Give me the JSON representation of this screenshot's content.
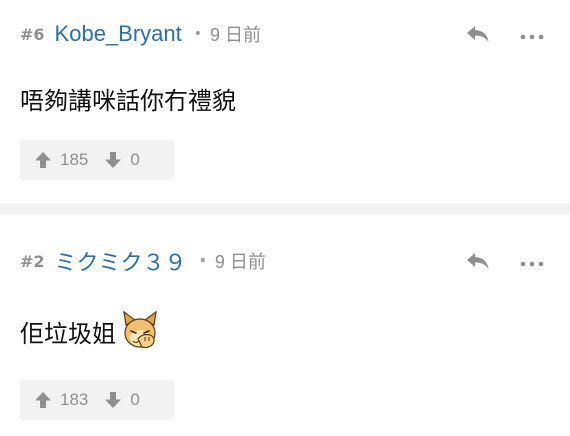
{
  "posts": [
    {
      "number": "#6",
      "username": "Kobe_Bryant",
      "separator": "•",
      "time": "9 日前",
      "content": "唔夠講咪話你冇禮貌",
      "upvotes": "185",
      "downvotes": "0"
    },
    {
      "number": "#2",
      "username": "ミクミク３９",
      "separator": "•",
      "time": "9 日前",
      "content": "佢垃圾姐",
      "emoji": "cat-facepalm-emoji",
      "upvotes": "183",
      "downvotes": "0"
    }
  ],
  "icons": {
    "reply": "reply-icon",
    "more": "more-icon",
    "upvote": "thumb-up-arrow-icon",
    "downvote": "thumb-down-arrow-icon"
  },
  "colors": {
    "username": "#2a6fa8",
    "meta": "#8f8f8f",
    "vote_bg": "#f2f2f2",
    "separator_bg": "#f2f2f2"
  }
}
